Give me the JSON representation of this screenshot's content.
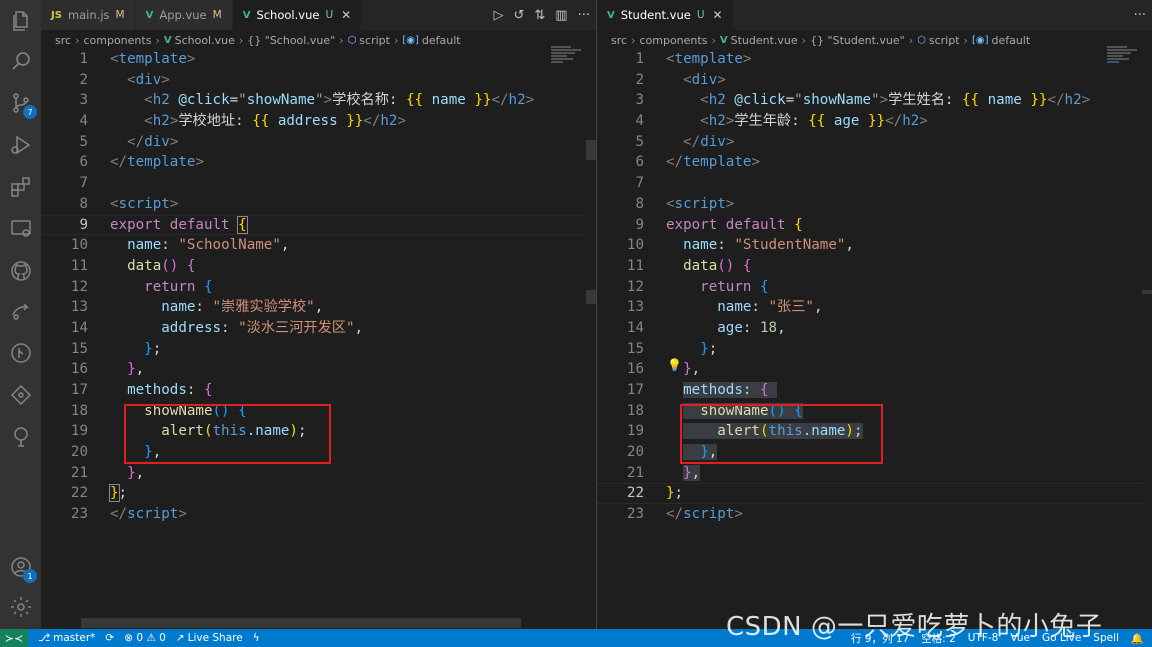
{
  "left_editor": {
    "tabs": [
      {
        "icon": "JS",
        "label": "main.js",
        "badge": "M"
      },
      {
        "icon": "V",
        "label": "App.vue",
        "badge": "M"
      },
      {
        "icon": "V",
        "label": "School.vue",
        "badge": "U",
        "active": true
      }
    ],
    "breadcrumb": [
      "src",
      "components",
      "School.vue",
      "{} \"School.vue\"",
      "script",
      "default"
    ],
    "current_line": 9
  },
  "right_editor": {
    "tabs": [
      {
        "icon": "V",
        "label": "Student.vue",
        "badge": "U",
        "active": true
      }
    ],
    "breadcrumb": [
      "src",
      "components",
      "Student.vue",
      "{} \"Student.vue\"",
      "script",
      "default"
    ],
    "current_line": 22
  },
  "activity_bar": {
    "source_control_badge": "7",
    "accounts_badge": "1"
  },
  "status_bar": {
    "branch": "master*",
    "problems": "⊗ 0 ⚠ 0",
    "live_share": "Live Share",
    "position": "行 9，列 17",
    "indent": "空格: 2",
    "encoding": "UTF-8",
    "language": "Vue",
    "go_live": "Go Live",
    "spell": "Spell"
  },
  "watermark": "CSDN @一只爱吃萝卜的小兔子"
}
